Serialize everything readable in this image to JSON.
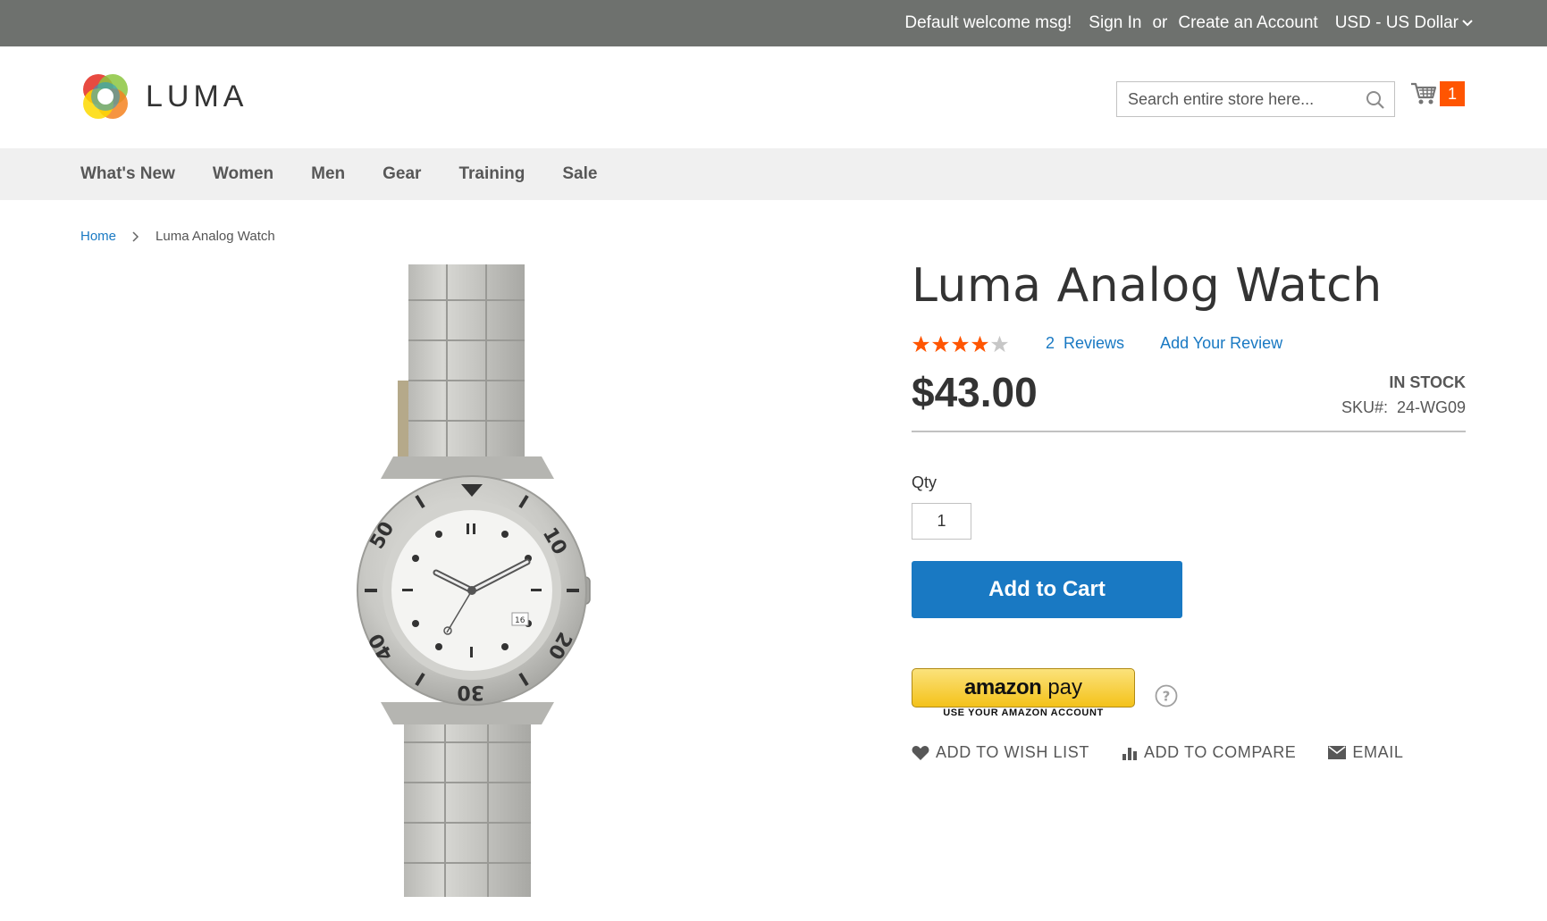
{
  "top_panel": {
    "welcome": "Default welcome msg!",
    "sign_in": "Sign In",
    "or": "or",
    "create_account": "Create an Account",
    "currency": "USD - US Dollar"
  },
  "header": {
    "logo_text": "LUMA",
    "search_placeholder": "Search entire store here...",
    "cart_count": "1"
  },
  "nav": {
    "items": [
      "What's New",
      "Women",
      "Men",
      "Gear",
      "Training",
      "Sale"
    ]
  },
  "breadcrumb": {
    "home": "Home",
    "current": "Luma Analog Watch"
  },
  "product": {
    "title": "Luma Analog Watch",
    "rating_stars": 4,
    "rating_max": 5,
    "reviews_count": "2",
    "reviews_label": "Reviews",
    "add_review": "Add Your Review",
    "price": "$43.00",
    "stock": "In stock",
    "sku_label": "SKU#:",
    "sku": "24-WG09",
    "qty_label": "Qty",
    "qty_value": "1",
    "add_to_cart": "Add to Cart",
    "amazon_pay_word": "amazon",
    "amazon_pay_pay": "pay",
    "amazon_pay_sub": "USE YOUR AMAZON ACCOUNT",
    "watch_dial_numbers": [
      "10",
      "20",
      "30",
      "40",
      "50"
    ],
    "watch_date": "16",
    "actions": {
      "wishlist": "Add to Wish List",
      "compare": "Add to Compare",
      "email": "Email"
    }
  },
  "colors": {
    "top_panel_bg": "#6e716e",
    "nav_bg": "#f0f0f0",
    "link": "#1979c3",
    "button_primary": "#1979c3",
    "cart_badge": "#ff5501",
    "star_active": "#ff5501",
    "star_inactive": "#c7c7c7"
  }
}
